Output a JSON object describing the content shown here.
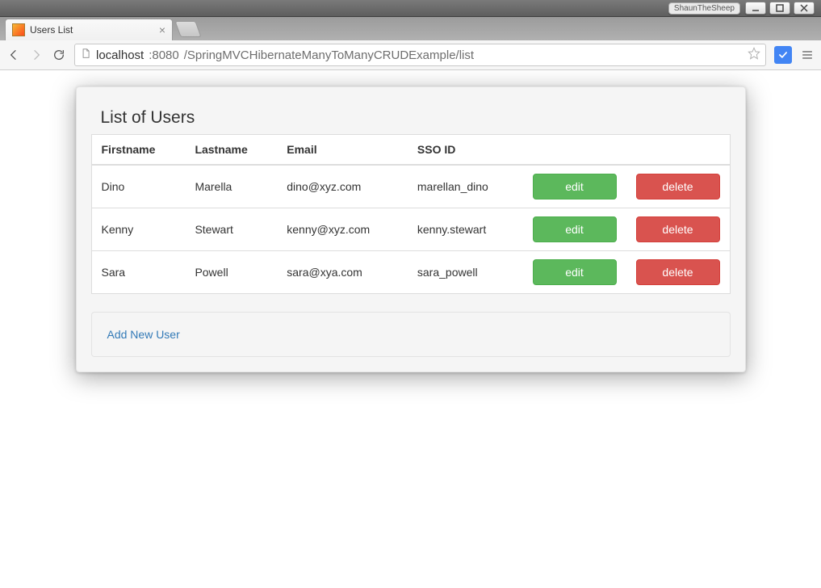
{
  "os": {
    "user_badge": "ShaunTheSheep"
  },
  "browser": {
    "tab_title": "Users List",
    "url_host": "localhost",
    "url_port": ":8080",
    "url_path": "/SpringMVCHibernateManyToManyCRUDExample/list"
  },
  "page": {
    "heading": "List of Users",
    "add_link_label": "Add New User",
    "edit_label": "edit",
    "delete_label": "delete",
    "columns": {
      "firstname": "Firstname",
      "lastname": "Lastname",
      "email": "Email",
      "sso_id": "SSO ID"
    },
    "users": [
      {
        "firstname": "Dino",
        "lastname": "Marella",
        "email": "dino@xyz.com",
        "sso_id": "marellan_dino"
      },
      {
        "firstname": "Kenny",
        "lastname": "Stewart",
        "email": "kenny@xyz.com",
        "sso_id": "kenny.stewart"
      },
      {
        "firstname": "Sara",
        "lastname": "Powell",
        "email": "sara@xya.com",
        "sso_id": "sara_powell"
      }
    ]
  }
}
